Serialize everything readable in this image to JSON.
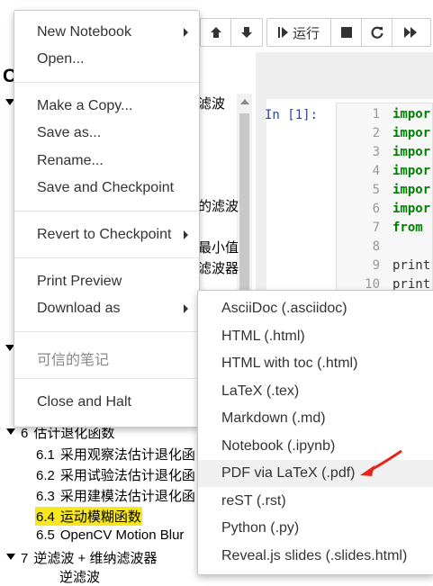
{
  "toolbar": {
    "run_label": "运行"
  },
  "toc": {
    "title_initial": "C",
    "fragments": [
      "滤波",
      "的滤波",
      "最小值",
      "滤波器"
    ],
    "items": [
      {
        "num": "6",
        "label": "估计退化函数",
        "level": 1,
        "expanded": true
      },
      {
        "num": "6.1",
        "label": "采用观察法估计退化函",
        "level": 2
      },
      {
        "num": "6.2",
        "label": "采用试验法估计退化函",
        "level": 2
      },
      {
        "num": "6.3",
        "label": "采用建模法估计退化函",
        "level": 2
      },
      {
        "num": "6.4",
        "label": "运动模糊函数",
        "level": 2,
        "highlighted": true
      },
      {
        "num": "6.5",
        "label": "OpenCV Motion Blur",
        "level": 2
      },
      {
        "num": "7",
        "label": "逆滤波 + 维纳滤波器",
        "level": 1,
        "expanded": true
      }
    ],
    "partial_next": "逆滤波"
  },
  "cell": {
    "prompt": "In  [1]:",
    "line_numbers": [
      "1",
      "2",
      "3",
      "4",
      "5",
      "6",
      "7",
      "8",
      "9",
      "10"
    ],
    "lines": [
      "impor",
      "impor",
      "impor",
      "impor",
      "impor",
      "impor",
      "from ",
      "",
      "print",
      "print"
    ]
  },
  "file_menu": {
    "items": [
      {
        "label": "New Notebook",
        "submenu": true
      },
      {
        "label": "Open..."
      },
      {
        "label": "Make a Copy..."
      },
      {
        "label": "Save as..."
      },
      {
        "label": "Rename..."
      },
      {
        "label": "Save and Checkpoint"
      },
      {
        "label": "Revert to Checkpoint",
        "submenu": true
      },
      {
        "label": "Print Preview"
      },
      {
        "label": "Download as",
        "submenu": true
      },
      {
        "label": "可信的笔记",
        "disabled": true
      },
      {
        "label": "Close and Halt"
      }
    ]
  },
  "download_submenu": {
    "items": [
      "AsciiDoc (.asciidoc)",
      "HTML (.html)",
      "HTML with toc (.html)",
      "LaTeX (.tex)",
      "Markdown (.md)",
      "Notebook (.ipynb)",
      "PDF via LaTeX (.pdf)",
      "reST (.rst)",
      "Python (.py)",
      "Reveal.js slides (.slides.html)"
    ],
    "active_index": 6
  },
  "colors": {
    "highlight": "#f8e71c",
    "arrow": "#e8231c",
    "keyword": "#008000",
    "prompt": "#303f9f"
  }
}
